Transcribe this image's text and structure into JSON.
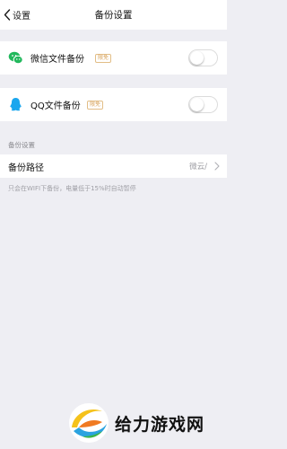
{
  "navbar": {
    "back_label": "设置",
    "title": "备份设置"
  },
  "wechat_backup": {
    "label": "微信文件备份",
    "badge": "限免",
    "toggle_on": false,
    "icon_color": "#21b85c"
  },
  "qq_backup": {
    "label": "QQ文件备份",
    "badge": "限免",
    "toggle_on": false,
    "icon_color": "#1aa6ee"
  },
  "backup_section": {
    "header": "备份设置",
    "path_label": "备份路径",
    "path_value": "微云/",
    "hint": "只会在WIFI下备份，电量低于15%时自动暂停"
  },
  "watermark": {
    "text": "给力游戏网"
  },
  "colors": {
    "background": "#eeeef3",
    "badge": "#d7a25a"
  }
}
